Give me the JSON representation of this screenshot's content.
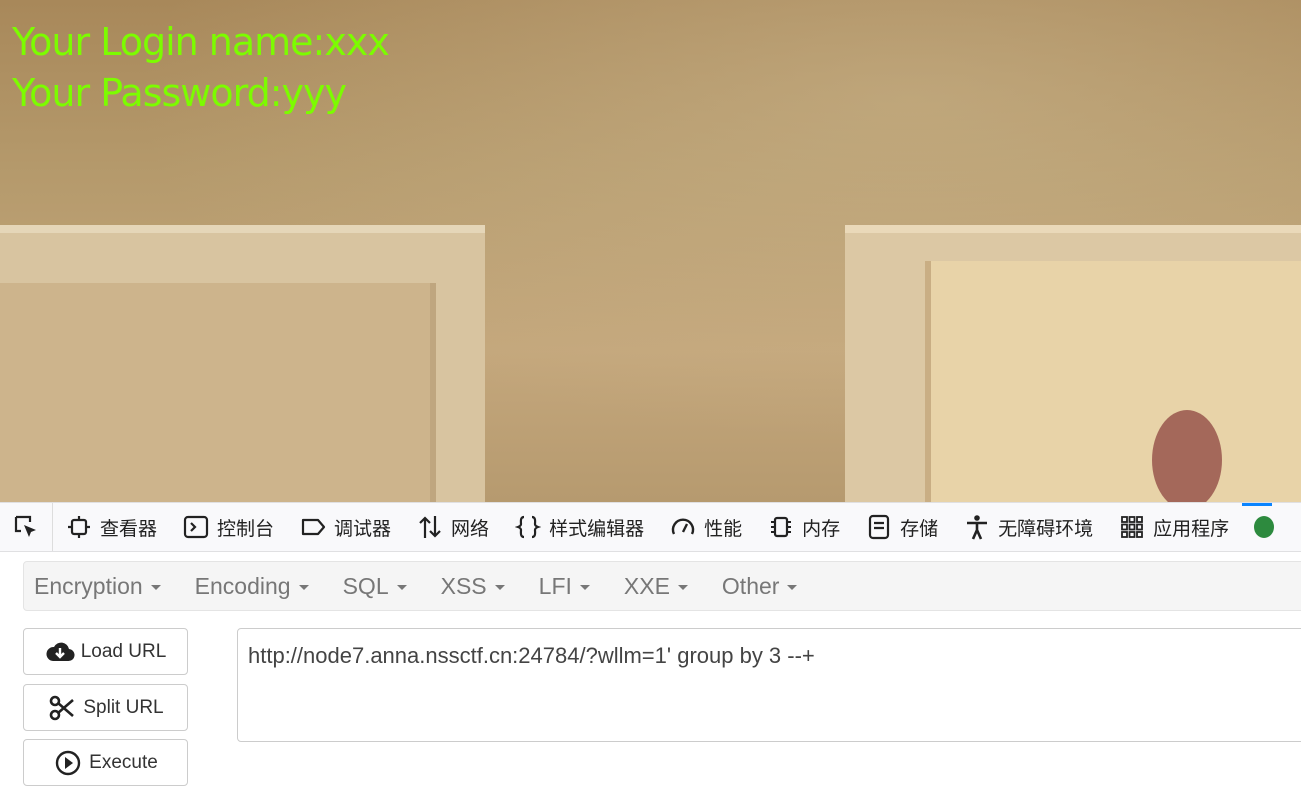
{
  "page": {
    "login_name_line": "Your Login name:xxx",
    "password_line": "Your Password:yyy",
    "text_color": "#7cfc00"
  },
  "devtools": {
    "tabs": [
      {
        "label": "查看器",
        "icon": "inspector-icon"
      },
      {
        "label": "控制台",
        "icon": "console-icon"
      },
      {
        "label": "调试器",
        "icon": "debugger-icon"
      },
      {
        "label": "网络",
        "icon": "network-icon"
      },
      {
        "label": "样式编辑器",
        "icon": "style-editor-icon"
      },
      {
        "label": "性能",
        "icon": "performance-icon"
      },
      {
        "label": "内存",
        "icon": "memory-icon"
      },
      {
        "label": "存储",
        "icon": "storage-icon"
      },
      {
        "label": "无障碍环境",
        "icon": "accessibility-icon"
      },
      {
        "label": "应用程序",
        "icon": "application-icon"
      }
    ],
    "active_accent": "#0a84ff"
  },
  "hackbar": {
    "menus": [
      "Encryption",
      "Encoding",
      "SQL",
      "XSS",
      "LFI",
      "XXE",
      "Other"
    ],
    "buttons": {
      "load_url": "Load URL",
      "split_url": "Split URL",
      "execute": "Execute"
    },
    "url_value": "http://node7.anna.nssctf.cn:24784/?wllm=1' group by 3 --+"
  }
}
